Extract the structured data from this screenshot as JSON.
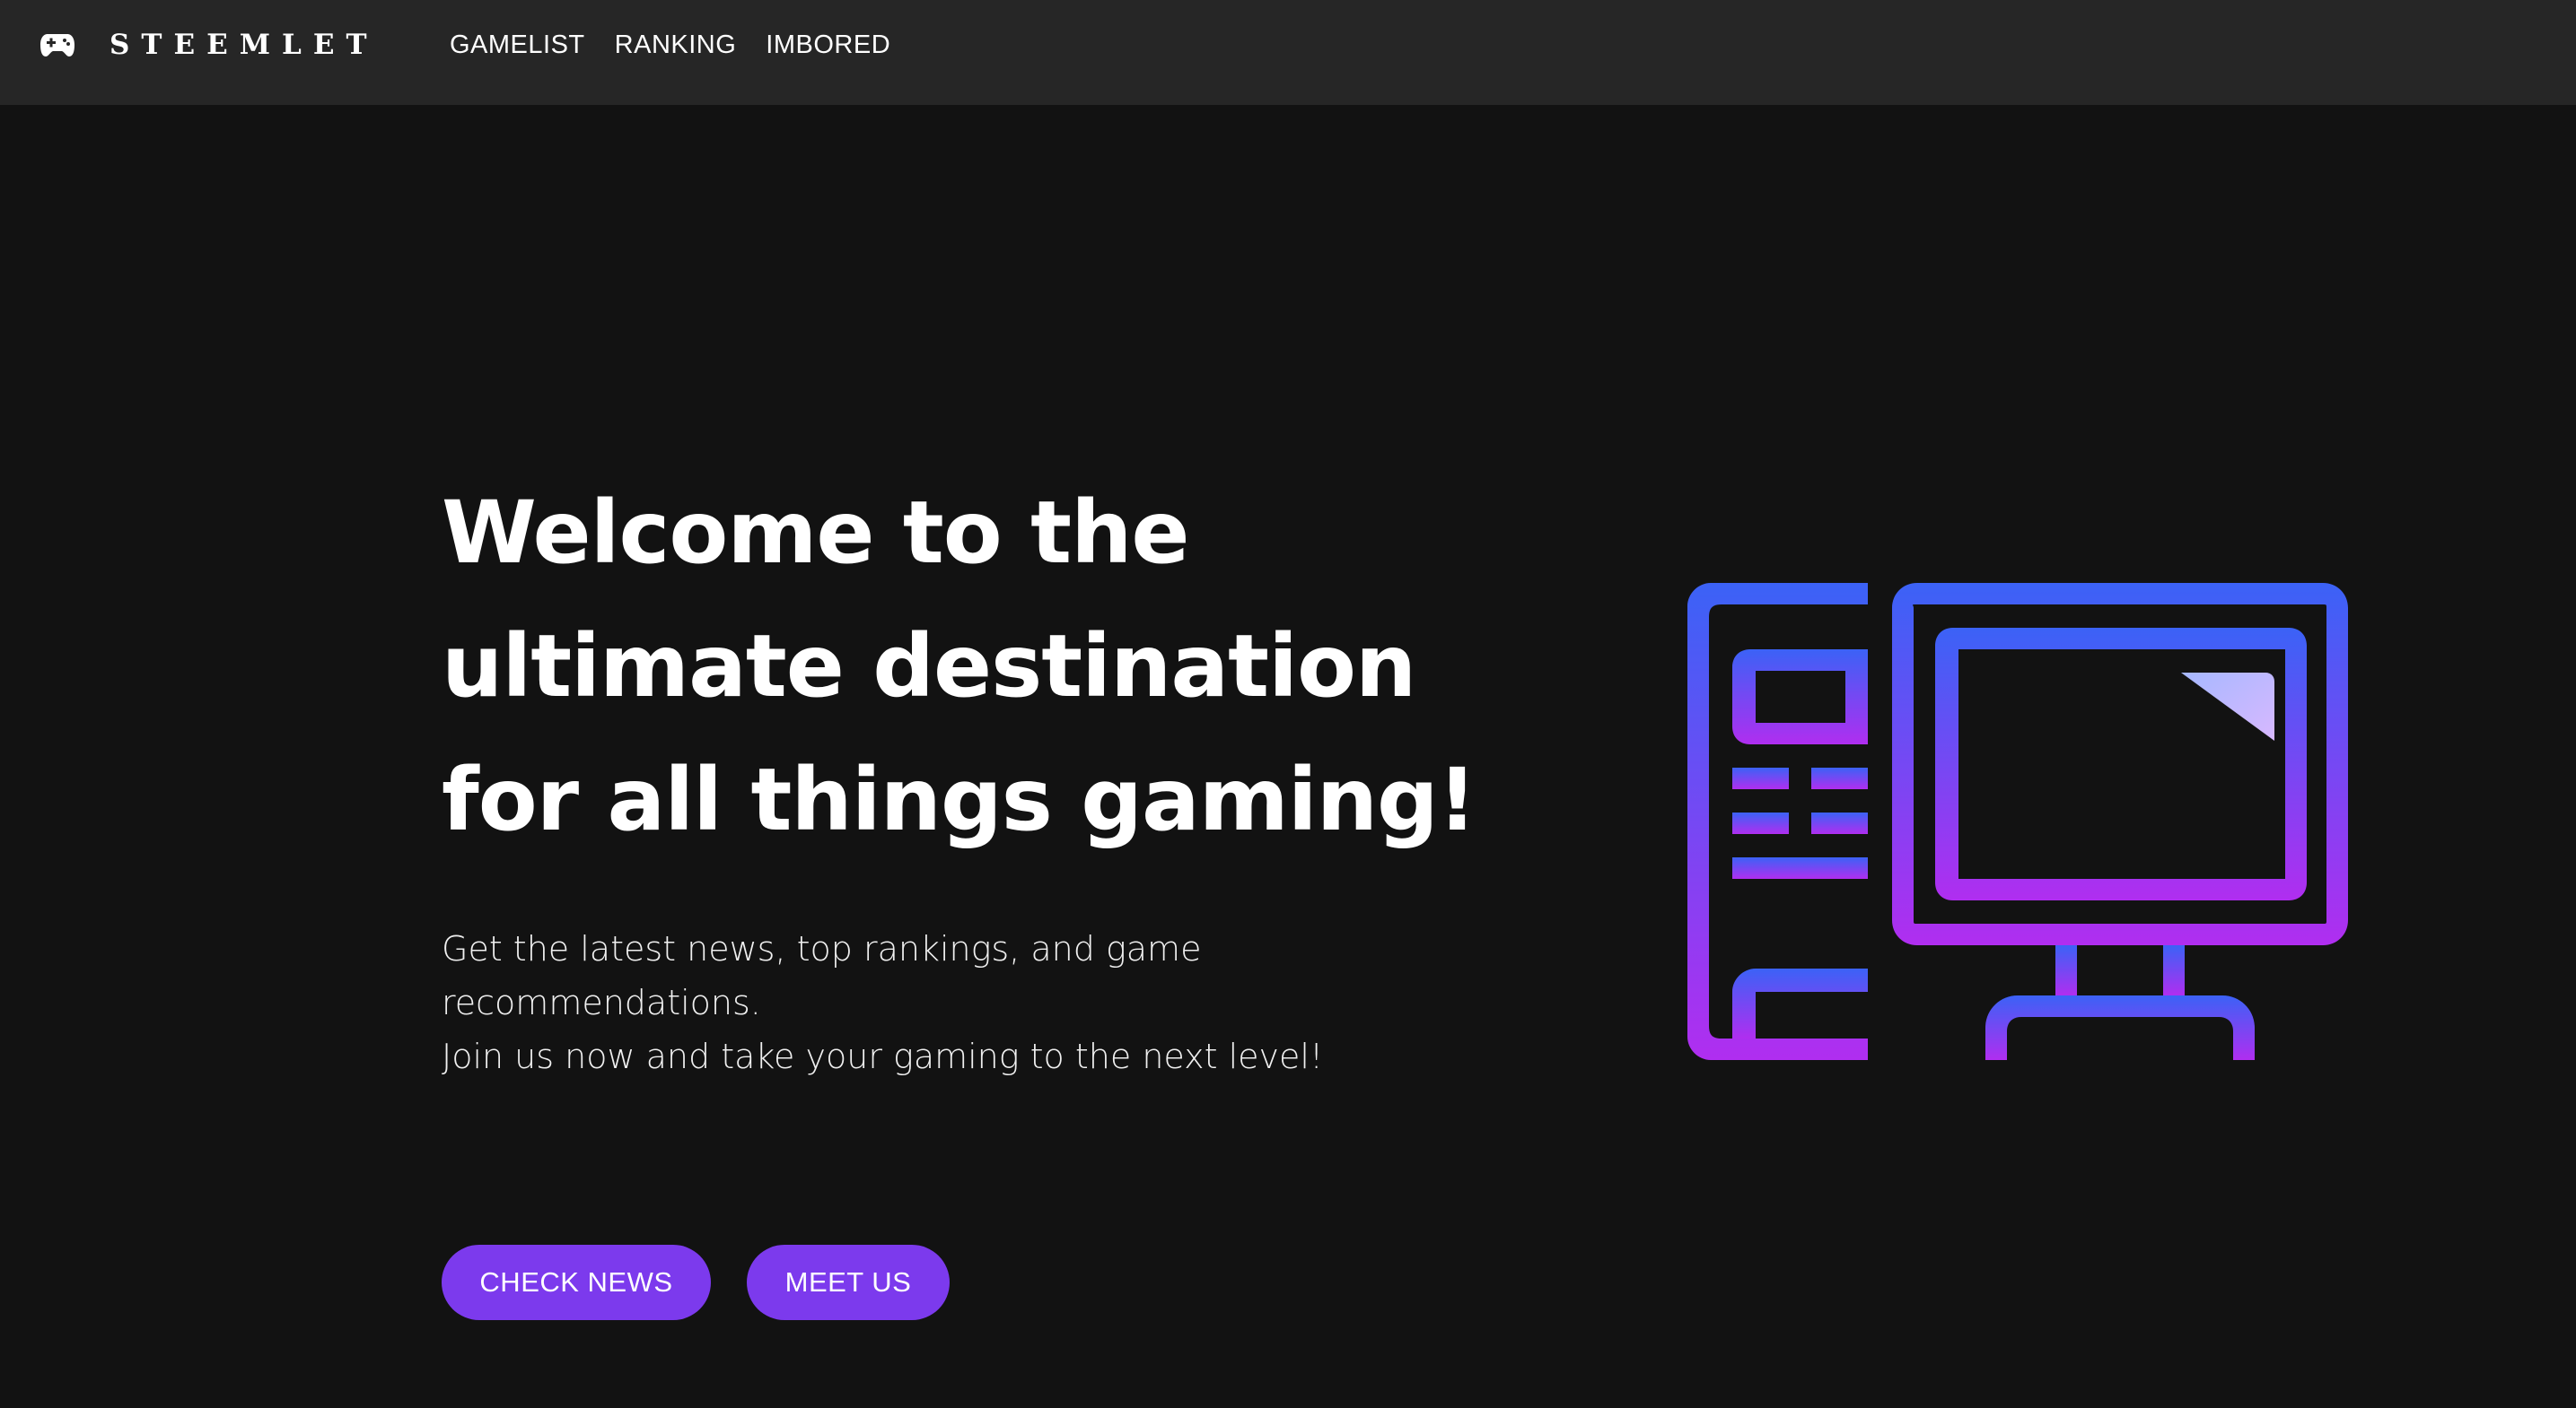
{
  "nav": {
    "brand_name": "STEEMLET",
    "brand_icon": "gamepad-icon",
    "links": [
      {
        "label": "GAMELIST"
      },
      {
        "label": "RANKING"
      },
      {
        "label": "IMBORED"
      }
    ]
  },
  "hero": {
    "title": "Welcome to the ultimate destination for all things gaming!",
    "description_line1": "Get the latest news, top rankings, and game recommendations.",
    "description_line2": "Join us now and take your gaming to the next level!",
    "illustration_icon": "desktop-computer-icon"
  },
  "buttons": {
    "check_news": "CHECK NEWS",
    "meet_us": "MEET US"
  },
  "colors": {
    "background": "#121212",
    "navbar": "#262626",
    "accent": "#7c3aed",
    "gradient_top": "#3b62f6",
    "gradient_bottom": "#b02ef0"
  }
}
